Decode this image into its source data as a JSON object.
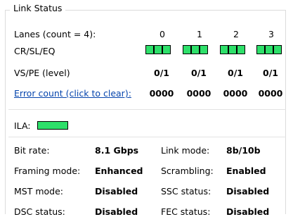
{
  "group": {
    "title": "Link Status"
  },
  "lanes": {
    "label": "Lanes (count = 4):",
    "indices": [
      "0",
      "1",
      "2",
      "3"
    ]
  },
  "cr_sl_eq": {
    "label": "CR/SL/EQ",
    "lanes": [
      {
        "cr": true,
        "sl": true,
        "eq": true
      },
      {
        "cr": true,
        "sl": true,
        "eq": true
      },
      {
        "cr": true,
        "sl": true,
        "eq": true
      },
      {
        "cr": true,
        "sl": true,
        "eq": true
      }
    ],
    "ok_color": "#2ee06a"
  },
  "vs_pe": {
    "label": "VS/PE (level)",
    "values": [
      "0/1",
      "0/1",
      "0/1",
      "0/1"
    ]
  },
  "error_count": {
    "label": "Error count (click to clear):",
    "values": [
      "0000",
      "0000",
      "0000",
      "0000"
    ]
  },
  "ila": {
    "label": "ILA:",
    "status": "ok"
  },
  "details": {
    "bit_rate_label": "Bit rate:",
    "bit_rate": "8.1 Gbps",
    "link_mode_label": "Link mode:",
    "link_mode": "8b/10b",
    "framing_mode_label": "Framing mode:",
    "framing_mode": "Enhanced",
    "scrambling_label": "Scrambling:",
    "scrambling": "Enabled",
    "mst_mode_label": "MST mode:",
    "mst_mode": "Disabled",
    "ssc_status_label": "SSC status:",
    "ssc_status": "Disabled",
    "dsc_status_label": "DSC status:",
    "dsc_status": "Disabled",
    "fec_status_label": "FEC status:",
    "fec_status": "Disabled"
  }
}
